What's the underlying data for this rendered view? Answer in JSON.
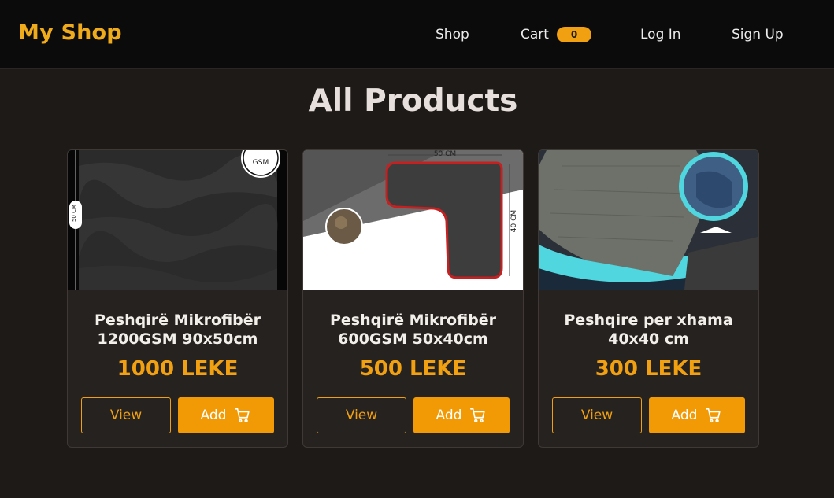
{
  "header": {
    "brand": "My Shop",
    "nav": {
      "shop": "Shop",
      "cart": "Cart",
      "cart_count": "0",
      "login": "Log In",
      "signup": "Sign Up"
    }
  },
  "main": {
    "title": "All Products",
    "products": [
      {
        "title_line1": "Peshqirë Mikrofibër",
        "title_line2": "1200GSM 90x50cm",
        "price": "1000 LEKE",
        "view_label": "View",
        "add_label": "Add",
        "image_labels": {
          "side": "50 CM",
          "badge": "GSM"
        }
      },
      {
        "title_line1": "Peshqirë Mikrofibër",
        "title_line2": "600GSM 50x40cm",
        "price": "500 LEKE",
        "view_label": "View",
        "add_label": "Add",
        "image_labels": {
          "top": "50 CM",
          "side": "40 CM"
        }
      },
      {
        "title_line1": "Peshqire per xhama",
        "title_line2": "40x40 cm",
        "price": "300 LEKE",
        "view_label": "View",
        "add_label": "Add"
      }
    ]
  },
  "colors": {
    "accent": "#f0a010",
    "background": "#1e1a18",
    "navbar": "#0c0b0b",
    "card": "#26221f"
  },
  "icons": [
    "cart-icon"
  ]
}
